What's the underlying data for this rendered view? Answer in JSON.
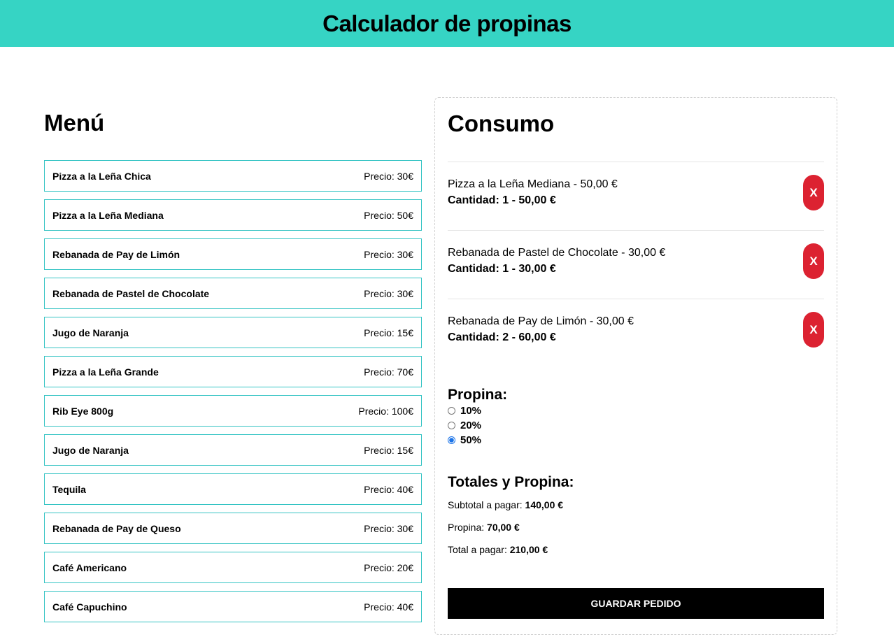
{
  "header": {
    "title": "Calculador de propinas"
  },
  "menu": {
    "title": "Menú",
    "items": [
      {
        "name": "Pizza a la Leña Chica",
        "price": "Precio: 30€"
      },
      {
        "name": "Pizza a la Leña Mediana",
        "price": "Precio: 50€"
      },
      {
        "name": "Rebanada de Pay de Limón",
        "price": "Precio: 30€"
      },
      {
        "name": "Rebanada de Pastel de Chocolate",
        "price": "Precio: 30€"
      },
      {
        "name": "Jugo de Naranja",
        "price": "Precio: 15€"
      },
      {
        "name": "Pizza a la Leña Grande",
        "price": "Precio: 70€"
      },
      {
        "name": "Rib Eye 800g",
        "price": "Precio: 100€"
      },
      {
        "name": "Jugo de Naranja",
        "price": "Precio: 15€"
      },
      {
        "name": "Tequila",
        "price": "Precio: 40€"
      },
      {
        "name": "Rebanada de Pay de Queso",
        "price": "Precio: 30€"
      },
      {
        "name": "Café Americano",
        "price": "Precio: 20€"
      },
      {
        "name": "Café Capuchino",
        "price": "Precio: 40€"
      }
    ]
  },
  "consumo": {
    "title": "Consumo",
    "items": [
      {
        "desc": "Pizza a la Leña Mediana - 50,00 €",
        "qty": "Cantidad: 1 - 50,00 €",
        "remove_label": "X"
      },
      {
        "desc": "Rebanada de Pastel de Chocolate - 30,00 €",
        "qty": "Cantidad: 1 - 30,00 €",
        "remove_label": "X"
      },
      {
        "desc": "Rebanada de Pay de Limón - 30,00 €",
        "qty": "Cantidad: 2 - 60,00 €",
        "remove_label": "X"
      }
    ],
    "tip": {
      "title": "Propina:",
      "options": [
        {
          "label": "10%",
          "selected": false
        },
        {
          "label": "20%",
          "selected": false
        },
        {
          "label": "50%",
          "selected": true
        }
      ]
    },
    "totals": {
      "title": "Totales y Propina:",
      "subtotal_label": "Subtotal a pagar:",
      "subtotal_value": "140,00 €",
      "tip_label": "Propina:",
      "tip_value": "70,00 €",
      "total_label": "Total a pagar:",
      "total_value": "210,00 €"
    },
    "save_label": "Guardar pedido"
  },
  "colors": {
    "header_bg": "#36d4c4",
    "menu_border": "#36c4c4",
    "remove_button": "#dc2231",
    "save_button": "#000000"
  }
}
